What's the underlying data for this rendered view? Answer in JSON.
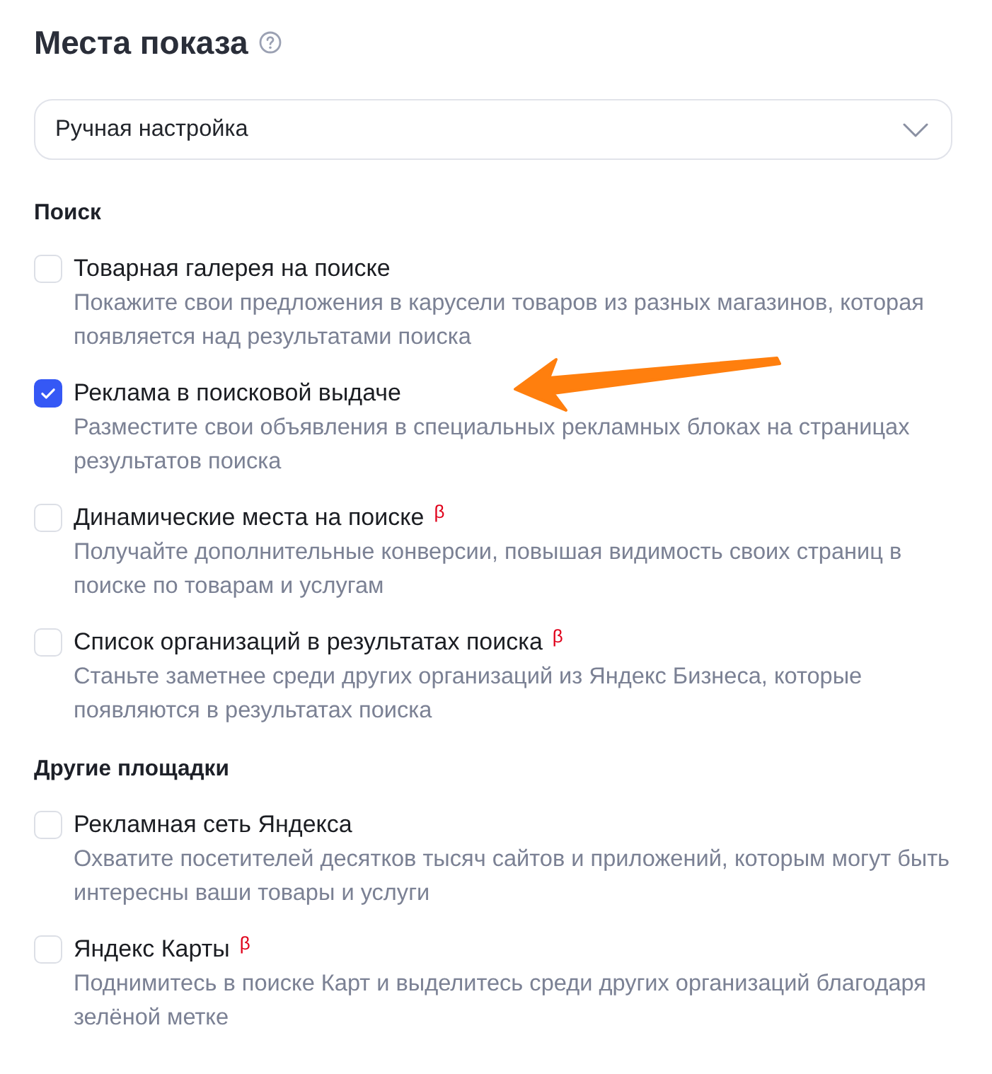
{
  "title": "Места показа",
  "select": {
    "value": "Ручная настройка"
  },
  "sections": [
    {
      "heading": "Поиск",
      "options": [
        {
          "label": "Товарная галерея на поиске",
          "description": "Покажите свои предложения в карусели товаров из разных магазинов, которая появляется над результатами поиска",
          "checked": false,
          "pointed_at": false
        },
        {
          "label": "Реклама в поисковой выдаче",
          "description": "Разместите свои объявления в специальных рекламных блоках на страницах результатов поиска",
          "checked": true,
          "pointed_at": true
        },
        {
          "label": "Динамические места на поиске",
          "badge": "β",
          "description": "Получайте дополнительные конверсии, повышая видимость своих страниц в поиске по товарам и услугам",
          "checked": false,
          "pointed_at": false
        },
        {
          "label": "Список организаций в результатах поиска",
          "badge": "β",
          "description": "Станьте заметнее среди других организаций из Яндекс Бизнеса, которые появляются в результатах поиска",
          "checked": false,
          "pointed_at": false
        }
      ]
    },
    {
      "heading": "Другие площадки",
      "options": [
        {
          "label": "Рекламная сеть Яндекса",
          "description": "Охватите посетителей десятков тысяч сайтов и приложений, которым могут быть интересны ваши товары и услуги",
          "checked": false,
          "pointed_at": false
        },
        {
          "label": "Яндекс Карты",
          "badge": "β",
          "description": "Поднимитесь в поиске Карт и выделитесь среди других организаций благодаря зелёной метке",
          "checked": false,
          "pointed_at": false
        }
      ]
    }
  ]
}
